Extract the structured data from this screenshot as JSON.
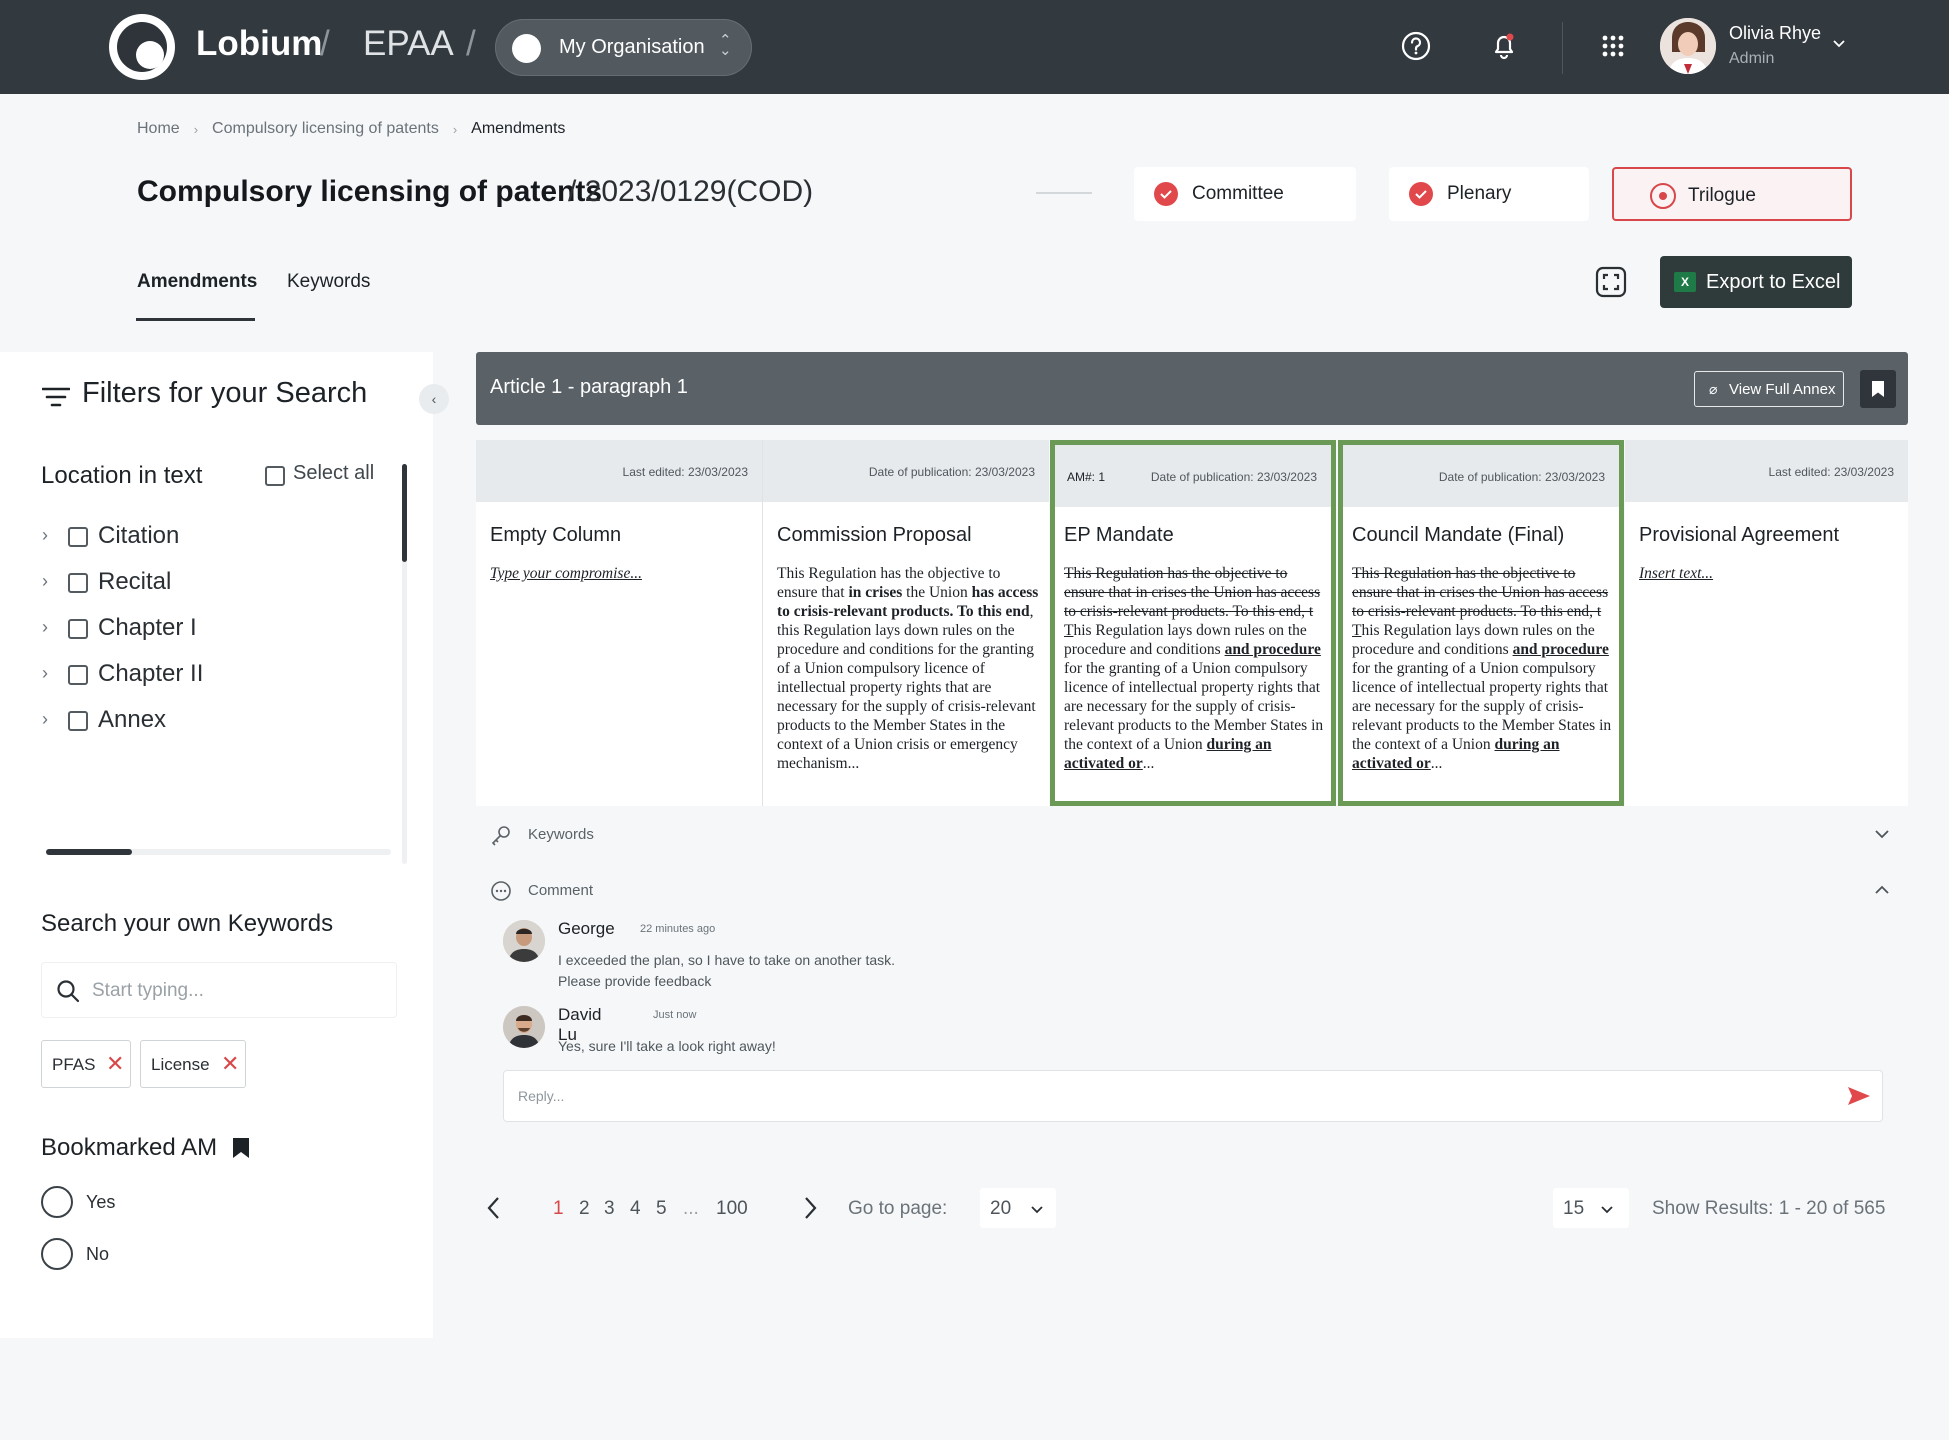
{
  "header": {
    "brand": "Lobium",
    "product": "EPAA",
    "slash": "/",
    "org_label": "My Organisation",
    "user_name": "Olivia Rhye",
    "user_role": "Admin"
  },
  "breadcrumb": [
    "Home",
    "Compulsory licensing of patents",
    "Amendments"
  ],
  "page": {
    "title": "Compulsory licensing of patents",
    "code": "/ 2023/0129(COD)"
  },
  "stages": [
    {
      "label": "Committee",
      "state": "done"
    },
    {
      "label": "Plenary",
      "state": "done"
    },
    {
      "label": "Trilogue",
      "state": "active"
    }
  ],
  "tabs": [
    {
      "label": "Amendments",
      "active": true
    },
    {
      "label": "Keywords",
      "active": false
    }
  ],
  "export_label": "Export to Excel",
  "filters": {
    "title": "Filters for your Search",
    "location_title": "Location in text",
    "select_all": "Select all",
    "tree": [
      "Citation",
      "Recital",
      "Chapter I",
      "Chapter II",
      "Annex"
    ],
    "keyword_title": "Search your own Keywords",
    "keyword_placeholder": "Start typing...",
    "chips": [
      "PFAS",
      "License"
    ],
    "bookmark_title": "Bookmarked AM",
    "bookmark_options": [
      "Yes",
      "No"
    ]
  },
  "article": {
    "title": "Article 1 - paragraph 1",
    "annex_label": "View Full Annex"
  },
  "columns": [
    {
      "meta_label": "Last edited:",
      "meta_date": "23/03/2023",
      "title": "Empty Column",
      "placeholder": "Type your compromise..."
    },
    {
      "meta_label": "Date of publication:",
      "meta_date": "23/03/2023",
      "title": "Commission Proposal"
    },
    {
      "am": "AM#: 1",
      "meta_label": "Date of publication:",
      "meta_date": "23/03/2023",
      "title": "EP Mandate",
      "highlight": "#6b9a57"
    },
    {
      "meta_label": "Date of publication:",
      "meta_date": "23/03/2023",
      "title": "Council Mandate (Final)",
      "highlight": "#6b9a57"
    },
    {
      "meta_label": "Last edited:",
      "meta_date": "23/03/2023",
      "title": "Provisional Agreement",
      "placeholder": "Insert text..."
    }
  ],
  "commission_text": {
    "a": "This Regulation has the objective to ensure that ",
    "b": "in crises",
    "c": " the Union ",
    "d": "has access to crisis-relevant products. To this end",
    "e": ", this Regulation lays down rules on the procedure and conditions for the granting of a Union compulsory licence of intellectual property rights that are necessary for the supply of crisis-relevant products to the Member States in the context of a Union crisis or emergency mechanism..."
  },
  "mandate_text": {
    "struck": "This Regulation has the objective to ensure that in crises the Union has access to crisis-relevant products. To this end, t",
    "u1": "T",
    "a": "his Regulation lays down rules on the  procedure and conditions ",
    "b": "and procedure",
    "c": " for the granting of a Union compulsory licence of intellectual property rights that are necessary for the supply of crisis-relevant products to the Member States  in the context of a Union ",
    "d": "during an activated or",
    "e": "..."
  },
  "keywords_row": "Keywords",
  "comment_row": "Comment",
  "comments": [
    {
      "name": "George",
      "time": "22 minutes ago",
      "lines": [
        "I exceeded the plan, so I have to take on another task.",
        "Please provide feedback"
      ]
    },
    {
      "name": "David Lu",
      "time": "Just now",
      "lines": [
        "Yes, sure I'll take a look right away!"
      ]
    }
  ],
  "reply_placeholder": "Reply...",
  "pagination": {
    "pages": [
      "1",
      "2",
      "3",
      "4",
      "5",
      "...",
      "100"
    ],
    "current": "1",
    "goto_label": "Go to page:",
    "goto_value": "20",
    "per_page": "15",
    "results": "Show Results: 1 - 20 of 565"
  },
  "colors": {
    "accent": "#d8474a",
    "topbar": "#32393f",
    "green": "#6b9a57",
    "excel": "#1e7a46"
  },
  "icons": [
    "help-icon",
    "bell-icon",
    "apps-grid-icon",
    "chevron-down-icon",
    "filter-icon",
    "search-icon",
    "close-icon",
    "bookmark-icon",
    "paperclip-icon",
    "key-icon",
    "comment-icon",
    "send-icon",
    "expand-icon",
    "excel-icon"
  ]
}
